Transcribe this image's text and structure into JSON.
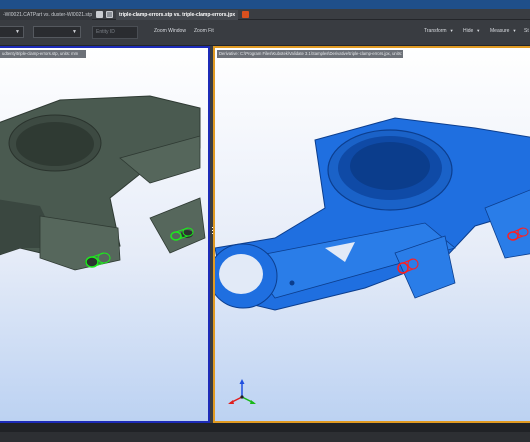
{
  "tabs": [
    {
      "label": "-WI0021.CATPart vs. duster-WI0021.stp"
    },
    {
      "label": "triple-clamp-errors.stp vs. triple-clamp-errors.jpx"
    }
  ],
  "toolbar": {
    "search_placeholder": "Entity ID",
    "zoom_window": "Zoom Window",
    "zoom_fit": "Zoom Fit",
    "transform": "Transform",
    "hide": "Hide",
    "measure": "Measure",
    "more": "St"
  },
  "viewports": {
    "left": {
      "path": "udtenty\\triple-clamp-errors.stp, units: mm",
      "part_color": "#4a5a50",
      "marker_color": "#1ee81e"
    },
    "right": {
      "path": "Derivative: C:\\Program Files\\Kubotek\\Validate 3.1\\Samples\\Derivative\\triple-clamp-errors.jpx, units: mm",
      "part_color": "#1f6fe0",
      "marker_color": "#ff1f1f"
    }
  },
  "colors": {
    "left_frame": "#1d2bb8",
    "right_frame": "#e09a22",
    "title_bar": "#1f4f8a"
  }
}
